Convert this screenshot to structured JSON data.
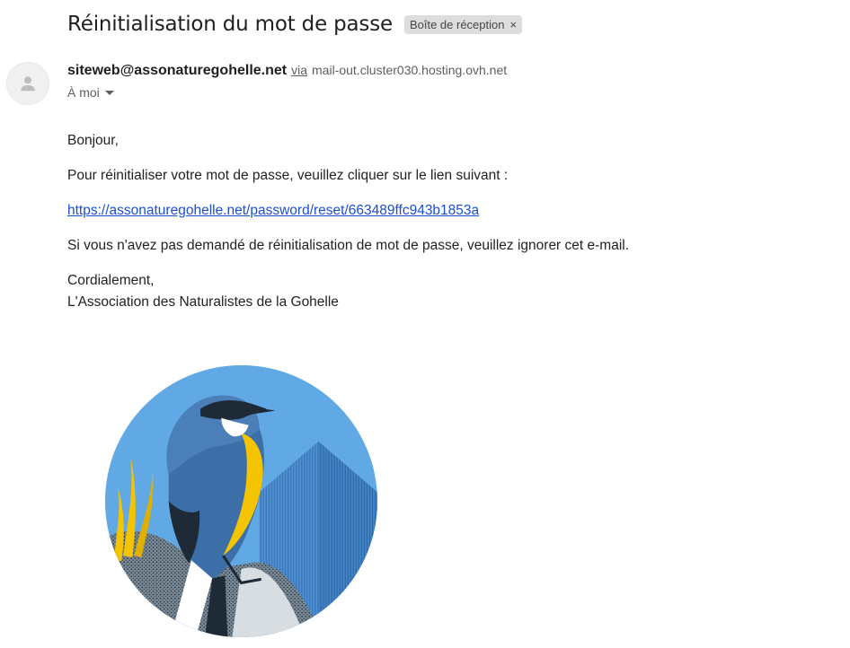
{
  "email": {
    "subject": "Réinitialisation du mot de passe",
    "label": "Boîte de réception",
    "label_close": "×",
    "sender": {
      "email": "siteweb@assonaturegohelle.net",
      "via_word": "via",
      "via_host": "mail-out.cluster030.hosting.ovh.net",
      "avatar_icon": "person-icon"
    },
    "recipient": "À moi",
    "body": {
      "greeting": "Bonjour,",
      "instruction": "Pour réinitialiser votre mot de passe, veuillez cliquer sur le lien suivant :",
      "reset_link": "https://assonaturegohelle.net/password/reset/663489ffc943b1853a",
      "ignore_notice": "Si vous n'avez pas demandé de réinitialisation de mot de passe, veuillez ignorer cet e-mail.",
      "closing": "Cordialement,",
      "signature": "L'Association des Naturalistes de la Gohelle"
    },
    "logo_icon": "bird-logo-icon"
  },
  "colors": {
    "link": "#1a4fd2",
    "chip_bg": "#dddddd",
    "logo_sky": "#5aa3e2",
    "logo_yellow": "#f5c400"
  }
}
